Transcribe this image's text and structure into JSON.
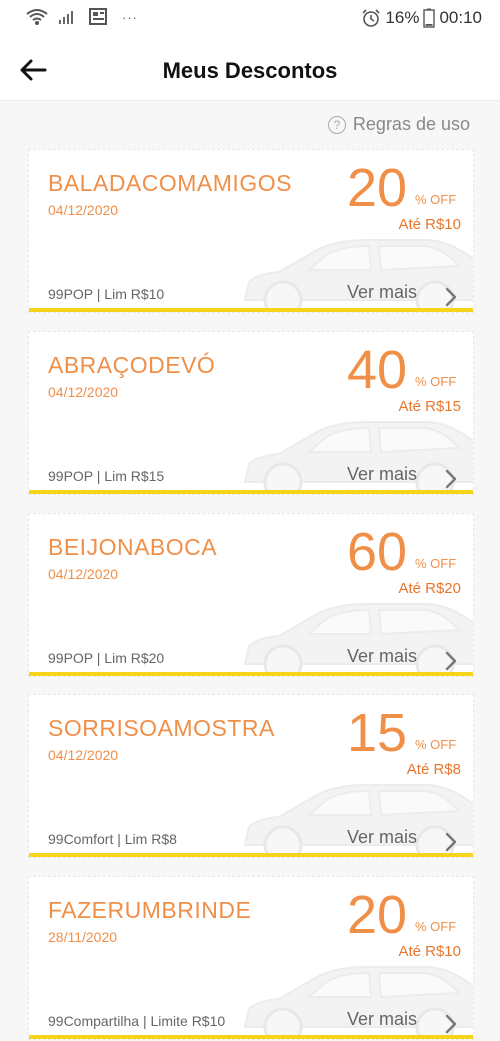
{
  "status_bar": {
    "battery": "16%",
    "time": "00:10",
    "dots": "···"
  },
  "header": {
    "title": "Meus Descontos"
  },
  "rules": {
    "label": "Regras de uso",
    "icon": "?"
  },
  "colors": {
    "accent": "#f08f48",
    "bar": "#f6d41b"
  },
  "coupons": [
    {
      "code": "BALADACOMAMIGOS",
      "date": "04/12/2020",
      "percent": "20",
      "off": "% OFF",
      "limit": "Até R$10",
      "product": "99POP | Lim R$10",
      "more": "Ver mais"
    },
    {
      "code": "ABRAÇODEVÓ",
      "date": "04/12/2020",
      "percent": "40",
      "off": "% OFF",
      "limit": "Até R$15",
      "product": "99POP | Lim R$15",
      "more": "Ver mais"
    },
    {
      "code": "BEIJONABOCA",
      "date": "04/12/2020",
      "percent": "60",
      "off": "% OFF",
      "limit": "Até R$20",
      "product": "99POP | Lim R$20",
      "more": "Ver mais"
    },
    {
      "code": "SORRISOAMOSTRA",
      "date": "04/12/2020",
      "percent": "15",
      "off": "% OFF",
      "limit": "Até R$8",
      "product": "99Comfort | Lim R$8",
      "more": "Ver mais"
    },
    {
      "code": "FAZERUMBRINDE",
      "date": "28/11/2020",
      "percent": "20",
      "off": "% OFF",
      "limit": "Até R$10",
      "product": "99Compartilha | Limite R$10",
      "more": "Ver mais"
    }
  ]
}
